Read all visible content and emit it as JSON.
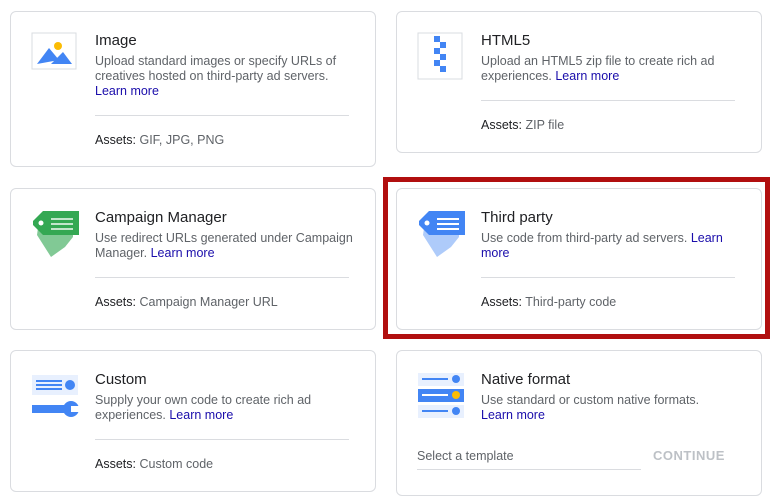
{
  "cards": {
    "image": {
      "title": "Image",
      "description": "Upload standard images or specify URLs of creatives hosted on third-party ad servers.",
      "learn_more": "Learn more",
      "assets_label": "Assets:",
      "assets_value": "GIF, JPG, PNG",
      "icon": "image-icon"
    },
    "html5": {
      "title": "HTML5",
      "description": "Upload an HTML5 zip file to create rich ad experiences.",
      "learn_more": "Learn more",
      "assets_label": "Assets:",
      "assets_value": "ZIP file",
      "icon": "zip-file-icon"
    },
    "campaign_manager": {
      "title": "Campaign Manager",
      "description": "Use redirect URLs generated under Campaign Manager.",
      "learn_more": "Learn more",
      "assets_label": "Assets:",
      "assets_value": "Campaign Manager URL",
      "icon": "green-tag-icon"
    },
    "third_party": {
      "title": "Third party",
      "description": "Use code from third-party ad servers.",
      "learn_more": "Learn more",
      "assets_label": "Assets:",
      "assets_value": "Third-party code",
      "icon": "blue-tag-icon"
    },
    "custom": {
      "title": "Custom",
      "description": "Supply your own code to create rich ad experiences.",
      "learn_more": "Learn more",
      "assets_label": "Assets:",
      "assets_value": "Custom code",
      "icon": "custom-code-icon"
    },
    "native": {
      "title": "Native format",
      "description": "Use standard or custom native formats.",
      "learn_more": "Learn more",
      "template_placeholder": "Select a template",
      "continue_label": "CONTINUE",
      "icon": "native-format-icon"
    }
  },
  "colors": {
    "highlight": "#b10f0f",
    "link": "#1a0dab",
    "blue": "#4285f4",
    "green": "#34a853",
    "yellow": "#fbbc04"
  }
}
